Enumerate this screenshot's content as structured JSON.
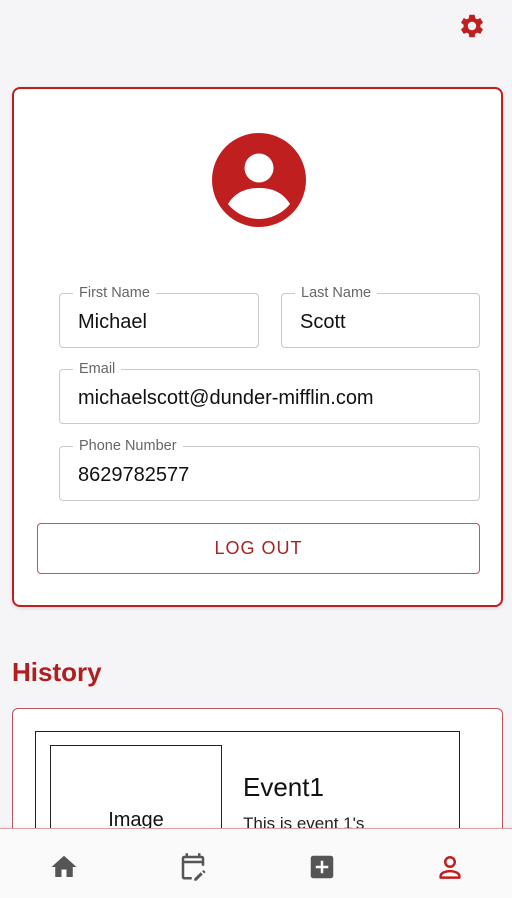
{
  "colors": {
    "accent": "#c01f1f",
    "nav_icon": "#555555",
    "nav_icon_active": "#c01f1f"
  },
  "header": {
    "settings_icon": "gear-icon"
  },
  "profile": {
    "avatar_icon": "account-circle-icon",
    "fields": {
      "first_name": {
        "label": "First Name",
        "value": "Michael"
      },
      "last_name": {
        "label": "Last Name",
        "value": "Scott"
      },
      "email": {
        "label": "Email",
        "value": "michaelscott@dunder-mifflin.com"
      },
      "phone": {
        "label": "Phone Number",
        "value": "8629782577"
      }
    },
    "logout_label": "LOG OUT"
  },
  "history": {
    "title": "History",
    "events": [
      {
        "image_label": "Image",
        "title": "Event1",
        "description": "This is event 1's"
      }
    ]
  },
  "bottom_nav": {
    "items": [
      {
        "icon": "home-icon",
        "active": false
      },
      {
        "icon": "calendar-edit-icon",
        "active": false
      },
      {
        "icon": "add-box-icon",
        "active": false
      },
      {
        "icon": "person-icon",
        "active": true
      }
    ]
  }
}
